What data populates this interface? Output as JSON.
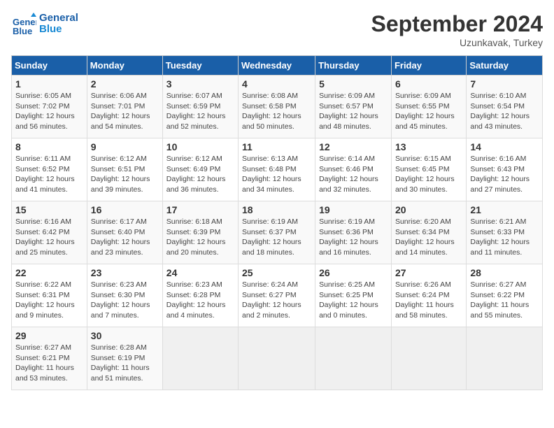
{
  "header": {
    "logo_line1": "General",
    "logo_line2": "Blue",
    "month_title": "September 2024",
    "subtitle": "Uzunkavak, Turkey"
  },
  "days_of_week": [
    "Sunday",
    "Monday",
    "Tuesday",
    "Wednesday",
    "Thursday",
    "Friday",
    "Saturday"
  ],
  "weeks": [
    [
      {
        "day": "1",
        "sunrise": "Sunrise: 6:05 AM",
        "sunset": "Sunset: 7:02 PM",
        "daylight": "Daylight: 12 hours and 56 minutes."
      },
      {
        "day": "2",
        "sunrise": "Sunrise: 6:06 AM",
        "sunset": "Sunset: 7:01 PM",
        "daylight": "Daylight: 12 hours and 54 minutes."
      },
      {
        "day": "3",
        "sunrise": "Sunrise: 6:07 AM",
        "sunset": "Sunset: 6:59 PM",
        "daylight": "Daylight: 12 hours and 52 minutes."
      },
      {
        "day": "4",
        "sunrise": "Sunrise: 6:08 AM",
        "sunset": "Sunset: 6:58 PM",
        "daylight": "Daylight: 12 hours and 50 minutes."
      },
      {
        "day": "5",
        "sunrise": "Sunrise: 6:09 AM",
        "sunset": "Sunset: 6:57 PM",
        "daylight": "Daylight: 12 hours and 48 minutes."
      },
      {
        "day": "6",
        "sunrise": "Sunrise: 6:09 AM",
        "sunset": "Sunset: 6:55 PM",
        "daylight": "Daylight: 12 hours and 45 minutes."
      },
      {
        "day": "7",
        "sunrise": "Sunrise: 6:10 AM",
        "sunset": "Sunset: 6:54 PM",
        "daylight": "Daylight: 12 hours and 43 minutes."
      }
    ],
    [
      {
        "day": "8",
        "sunrise": "Sunrise: 6:11 AM",
        "sunset": "Sunset: 6:52 PM",
        "daylight": "Daylight: 12 hours and 41 minutes."
      },
      {
        "day": "9",
        "sunrise": "Sunrise: 6:12 AM",
        "sunset": "Sunset: 6:51 PM",
        "daylight": "Daylight: 12 hours and 39 minutes."
      },
      {
        "day": "10",
        "sunrise": "Sunrise: 6:12 AM",
        "sunset": "Sunset: 6:49 PM",
        "daylight": "Daylight: 12 hours and 36 minutes."
      },
      {
        "day": "11",
        "sunrise": "Sunrise: 6:13 AM",
        "sunset": "Sunset: 6:48 PM",
        "daylight": "Daylight: 12 hours and 34 minutes."
      },
      {
        "day": "12",
        "sunrise": "Sunrise: 6:14 AM",
        "sunset": "Sunset: 6:46 PM",
        "daylight": "Daylight: 12 hours and 32 minutes."
      },
      {
        "day": "13",
        "sunrise": "Sunrise: 6:15 AM",
        "sunset": "Sunset: 6:45 PM",
        "daylight": "Daylight: 12 hours and 30 minutes."
      },
      {
        "day": "14",
        "sunrise": "Sunrise: 6:16 AM",
        "sunset": "Sunset: 6:43 PM",
        "daylight": "Daylight: 12 hours and 27 minutes."
      }
    ],
    [
      {
        "day": "15",
        "sunrise": "Sunrise: 6:16 AM",
        "sunset": "Sunset: 6:42 PM",
        "daylight": "Daylight: 12 hours and 25 minutes."
      },
      {
        "day": "16",
        "sunrise": "Sunrise: 6:17 AM",
        "sunset": "Sunset: 6:40 PM",
        "daylight": "Daylight: 12 hours and 23 minutes."
      },
      {
        "day": "17",
        "sunrise": "Sunrise: 6:18 AM",
        "sunset": "Sunset: 6:39 PM",
        "daylight": "Daylight: 12 hours and 20 minutes."
      },
      {
        "day": "18",
        "sunrise": "Sunrise: 6:19 AM",
        "sunset": "Sunset: 6:37 PM",
        "daylight": "Daylight: 12 hours and 18 minutes."
      },
      {
        "day": "19",
        "sunrise": "Sunrise: 6:19 AM",
        "sunset": "Sunset: 6:36 PM",
        "daylight": "Daylight: 12 hours and 16 minutes."
      },
      {
        "day": "20",
        "sunrise": "Sunrise: 6:20 AM",
        "sunset": "Sunset: 6:34 PM",
        "daylight": "Daylight: 12 hours and 14 minutes."
      },
      {
        "day": "21",
        "sunrise": "Sunrise: 6:21 AM",
        "sunset": "Sunset: 6:33 PM",
        "daylight": "Daylight: 12 hours and 11 minutes."
      }
    ],
    [
      {
        "day": "22",
        "sunrise": "Sunrise: 6:22 AM",
        "sunset": "Sunset: 6:31 PM",
        "daylight": "Daylight: 12 hours and 9 minutes."
      },
      {
        "day": "23",
        "sunrise": "Sunrise: 6:23 AM",
        "sunset": "Sunset: 6:30 PM",
        "daylight": "Daylight: 12 hours and 7 minutes."
      },
      {
        "day": "24",
        "sunrise": "Sunrise: 6:23 AM",
        "sunset": "Sunset: 6:28 PM",
        "daylight": "Daylight: 12 hours and 4 minutes."
      },
      {
        "day": "25",
        "sunrise": "Sunrise: 6:24 AM",
        "sunset": "Sunset: 6:27 PM",
        "daylight": "Daylight: 12 hours and 2 minutes."
      },
      {
        "day": "26",
        "sunrise": "Sunrise: 6:25 AM",
        "sunset": "Sunset: 6:25 PM",
        "daylight": "Daylight: 12 hours and 0 minutes."
      },
      {
        "day": "27",
        "sunrise": "Sunrise: 6:26 AM",
        "sunset": "Sunset: 6:24 PM",
        "daylight": "Daylight: 11 hours and 58 minutes."
      },
      {
        "day": "28",
        "sunrise": "Sunrise: 6:27 AM",
        "sunset": "Sunset: 6:22 PM",
        "daylight": "Daylight: 11 hours and 55 minutes."
      }
    ],
    [
      {
        "day": "29",
        "sunrise": "Sunrise: 6:27 AM",
        "sunset": "Sunset: 6:21 PM",
        "daylight": "Daylight: 11 hours and 53 minutes."
      },
      {
        "day": "30",
        "sunrise": "Sunrise: 6:28 AM",
        "sunset": "Sunset: 6:19 PM",
        "daylight": "Daylight: 11 hours and 51 minutes."
      },
      null,
      null,
      null,
      null,
      null
    ]
  ]
}
